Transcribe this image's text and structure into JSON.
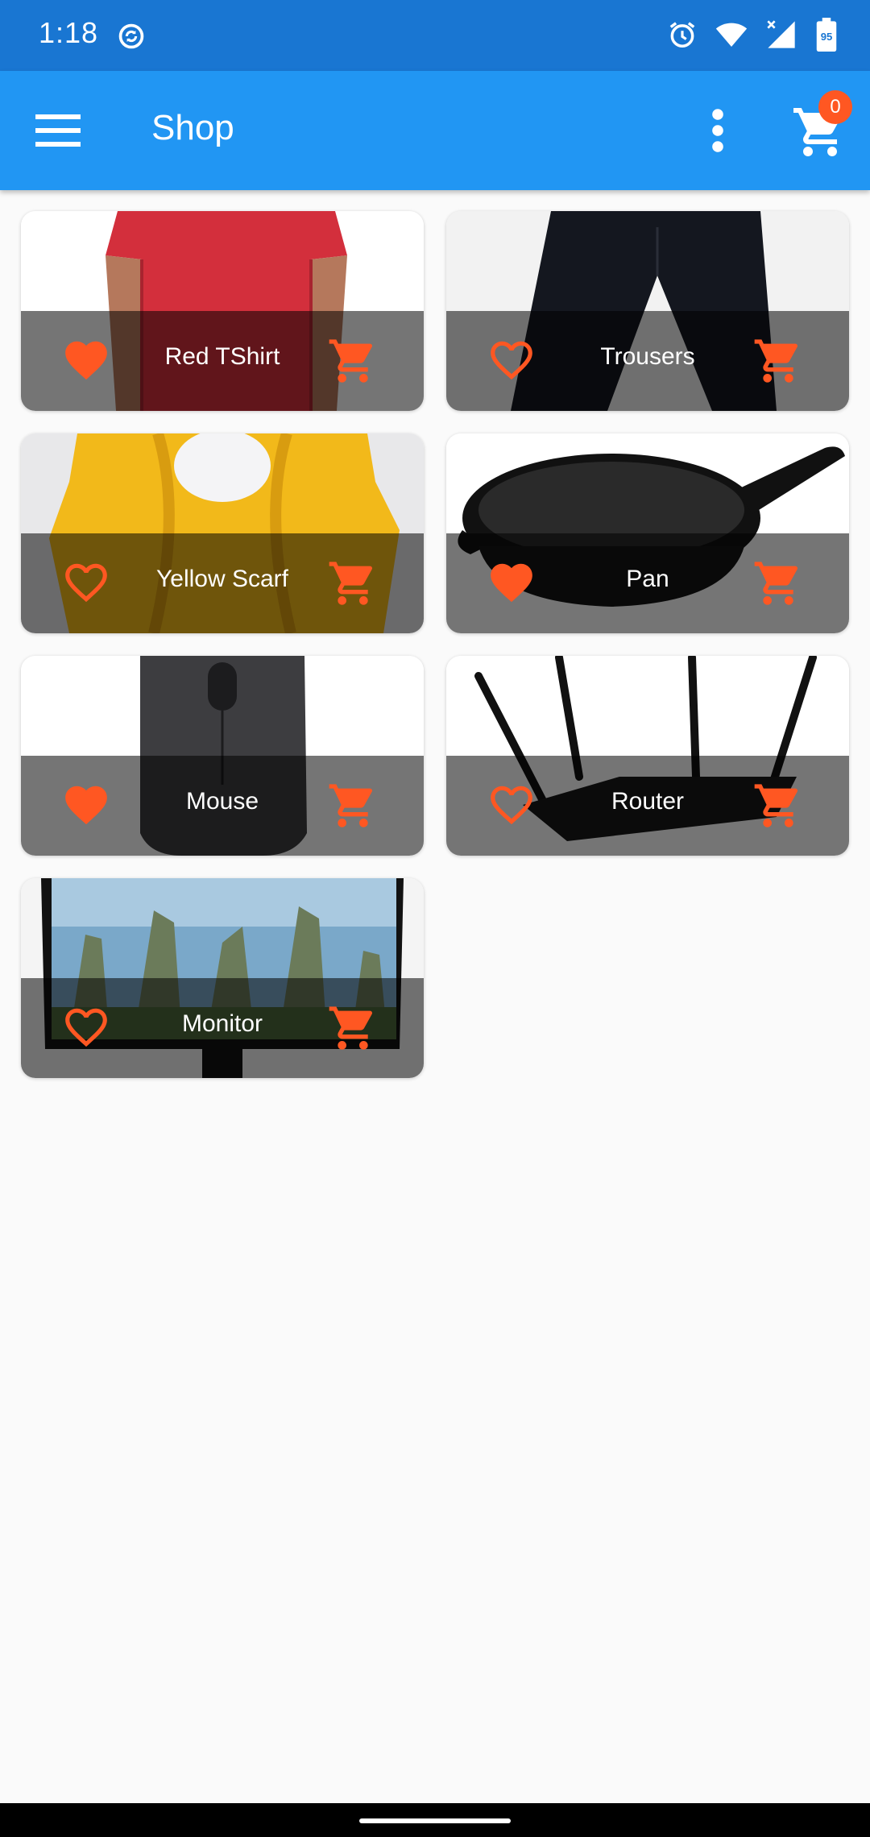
{
  "status_bar": {
    "time": "1:18",
    "battery": "95",
    "icons": [
      "sync-icon",
      "alarm-icon",
      "wifi-icon",
      "signal-icon",
      "battery-icon"
    ]
  },
  "app_bar": {
    "title": "Shop",
    "cart_count": "0",
    "icons": [
      "menu-icon",
      "more-vert-icon",
      "shopping-cart-icon"
    ]
  },
  "colors": {
    "status_bar": "#1976d2",
    "app_bar": "#2196f3",
    "accent": "#ff5722",
    "background": "#fafafa"
  },
  "products": [
    {
      "name": "Red TShirt",
      "favorite": true
    },
    {
      "name": "Trousers",
      "favorite": false
    },
    {
      "name": "Yellow Scarf",
      "favorite": false
    },
    {
      "name": "Pan",
      "favorite": true
    },
    {
      "name": "Mouse",
      "favorite": true
    },
    {
      "name": "Router",
      "favorite": false
    },
    {
      "name": "Monitor",
      "favorite": false
    }
  ]
}
